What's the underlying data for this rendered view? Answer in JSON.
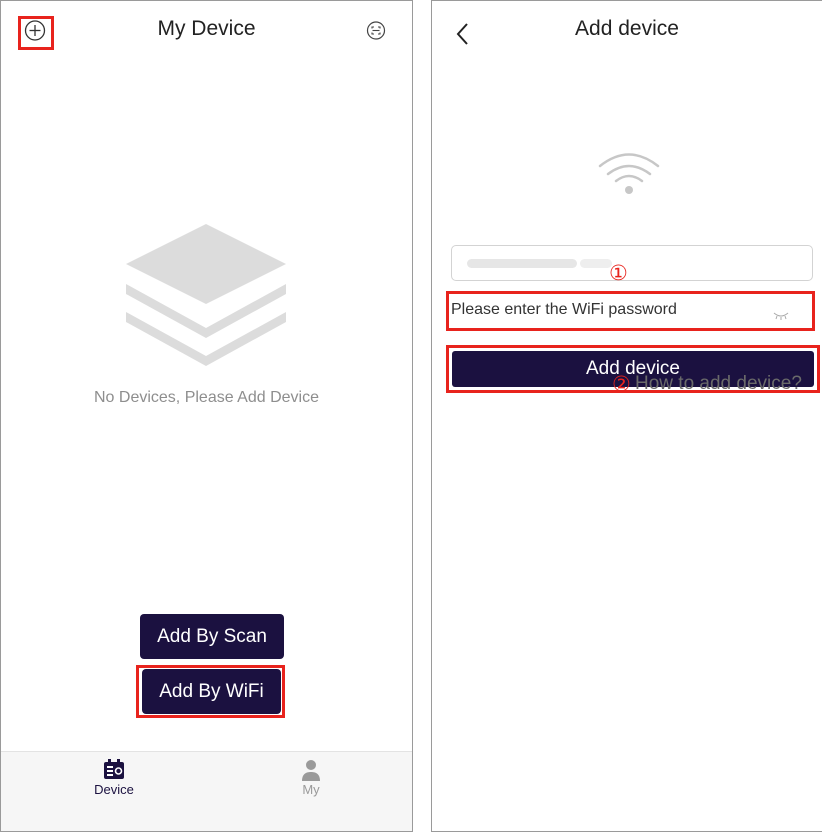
{
  "colors": {
    "highlight": "#e8231d",
    "button": "#1b1140",
    "tab_active": "#1b1140",
    "tab_inactive": "#9a9a9a"
  },
  "my_device": {
    "title": "My Device",
    "left_icon": "plus-circle-icon",
    "right_icon": "scan-icon",
    "empty_icon": "stacked-layers-icon",
    "empty_text": "No Devices, Please Add Device",
    "add_by_scan": "Add By Scan",
    "add_by_wifi": "Add By WiFi",
    "tabs": [
      {
        "label": "Device",
        "icon": "device-icon",
        "active": true
      },
      {
        "label": "My",
        "icon": "person-icon",
        "active": false
      }
    ]
  },
  "add_device": {
    "title": "Add device",
    "back_icon": "chevron-left-icon",
    "wifi_icon": "wifi-icon",
    "ssid_value": "",
    "password_placeholder": "Please enter the WiFi password",
    "eye_icon": "eye-closed-icon",
    "add_button": "Add device",
    "how_to": "How to add device?"
  },
  "annotations": {
    "step1": "①",
    "step2": "②"
  }
}
